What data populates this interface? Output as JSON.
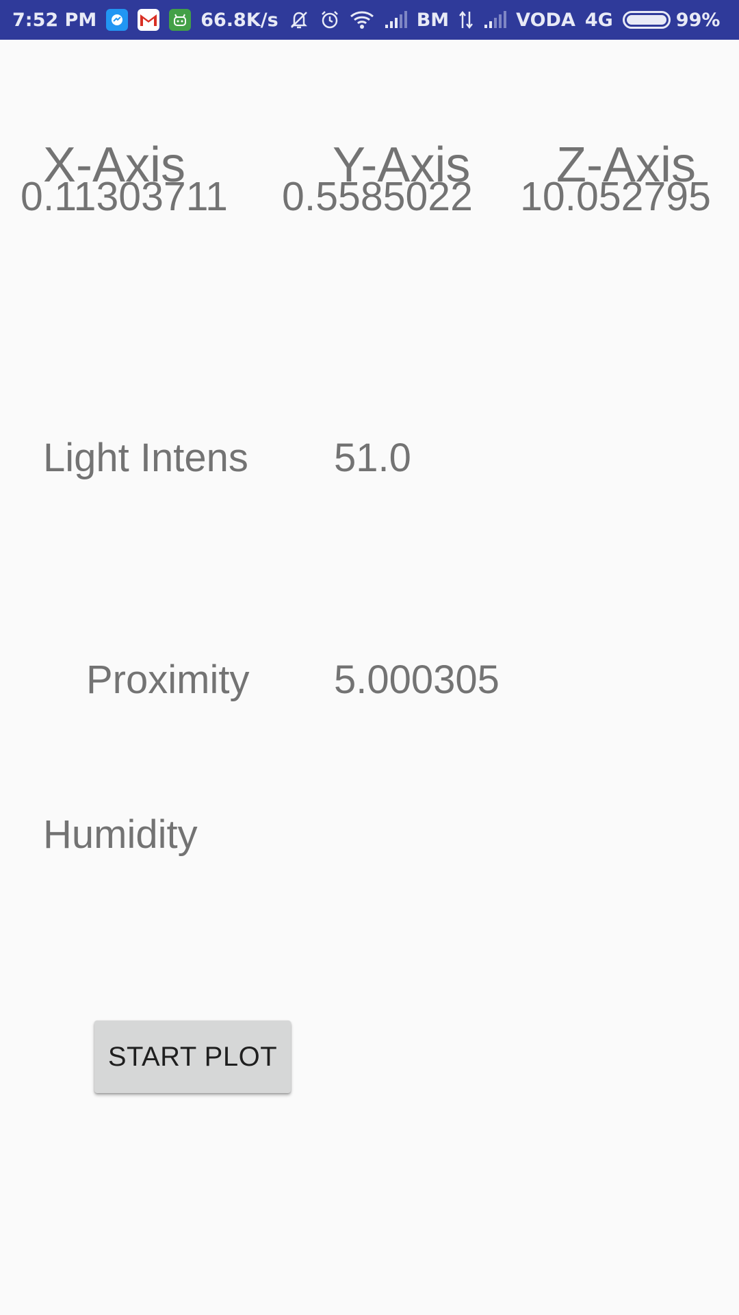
{
  "status_bar": {
    "time": "7:52 PM",
    "net_speed": "66.8K/s",
    "carrier1": "BM",
    "carrier2": "VODA",
    "network_type": "4G",
    "battery": "99%",
    "icons": [
      "messenger-icon",
      "gmail-icon",
      "android-app-icon",
      "mute-icon",
      "alarm-icon",
      "wifi-icon",
      "signal-icon",
      "data-arrows-icon",
      "battery-icon"
    ]
  },
  "axes": {
    "x": {
      "header": "X-Axis",
      "value": "0.11303711"
    },
    "y": {
      "header": "Y-Axis",
      "value": "0.5585022"
    },
    "z": {
      "header": "Z-Axis",
      "value": "10.052795"
    }
  },
  "sensors": {
    "light": {
      "label": "Light Intens",
      "value": "51.0"
    },
    "proximity": {
      "label": "Proximity",
      "value": "5.000305"
    },
    "humidity": {
      "label": "Humidity",
      "value": ""
    }
  },
  "button": {
    "label": "START PLOT"
  },
  "colors": {
    "status_bar": "#2f3a9a",
    "background": "#fafafa",
    "text": "#737373",
    "button": "#d6d7d7"
  }
}
